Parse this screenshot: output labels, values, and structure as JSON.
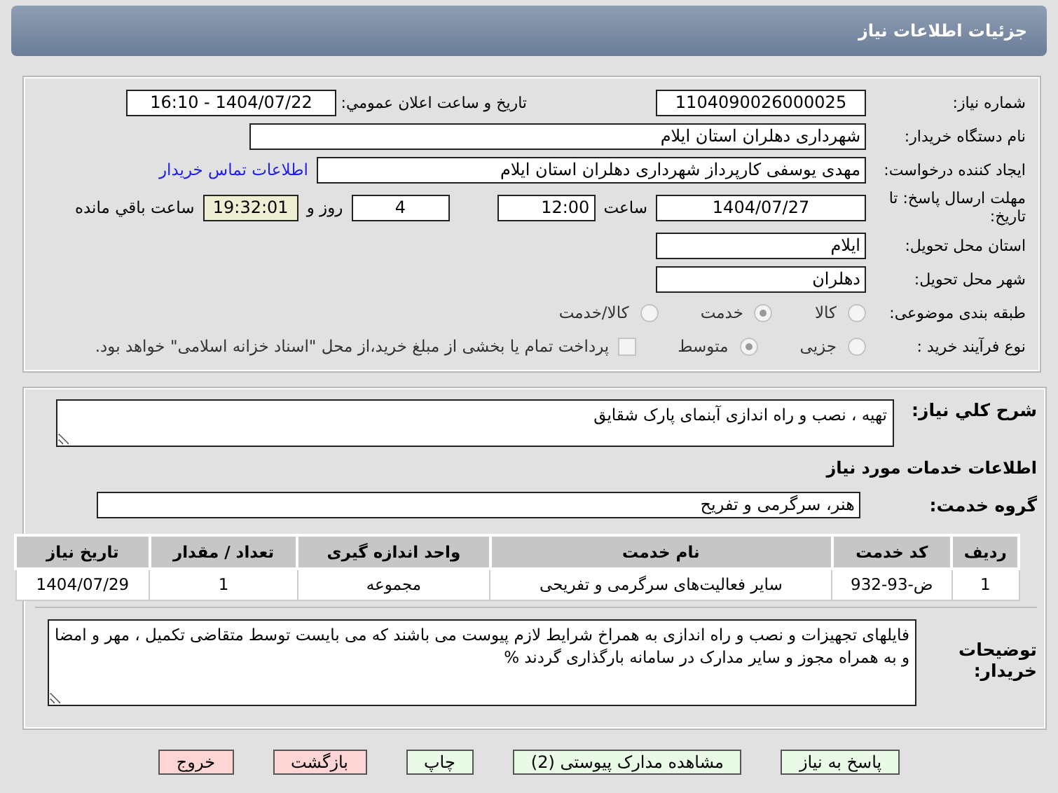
{
  "header": {
    "title": "جزئیات اطلاعات نیاز"
  },
  "details": {
    "need_number": {
      "label": "شماره نیاز:",
      "value": "1104090026000025"
    },
    "announce": {
      "label": "تاریخ و ساعت اعلان عمومي:",
      "value": "1404/07/22 - 16:10"
    },
    "buyer": {
      "label": "نام دستگاه خریدار:",
      "value": "شهرداری دهلران استان ایلام"
    },
    "creator": {
      "label": "ایجاد کننده درخواست:",
      "value": "مهدی یوسفی کارپرداز شهرداری دهلران استان ایلام",
      "link": "اطلاعات تماس خریدار"
    },
    "deadline": {
      "label": "مهلت ارسال پاسخ: تا تاریخ:",
      "date": "1404/07/27",
      "time_label": "ساعت",
      "time": "12:00",
      "days": "4",
      "days_label": "روز و",
      "remaining": "19:32:01",
      "remaining_label": "ساعت باقي مانده"
    },
    "province": {
      "label": "استان محل تحویل:",
      "value": "ایلام"
    },
    "city": {
      "label": "شهر محل تحویل:",
      "value": "دهلران"
    },
    "category": {
      "label": "طبقه بندی موضوعی:",
      "options": [
        {
          "label": "کالا",
          "selected": false
        },
        {
          "label": "خدمت",
          "selected": true
        },
        {
          "label": "کالا/خدمت",
          "selected": false
        }
      ]
    },
    "process": {
      "label": "نوع فرآیند خرید :",
      "options": [
        {
          "label": "جزیی",
          "selected": false
        },
        {
          "label": "متوسط",
          "selected": true
        }
      ],
      "treasury": {
        "checked": false,
        "text": "پرداخت تمام یا بخشی از مبلغ خرید،از محل \"اسناد خزانه اسلامی\" خواهد بود."
      }
    }
  },
  "summary": {
    "label": "شرح كلي نياز:",
    "value": "تهیه ، نصب و راه اندازی آبنمای پارک شقایق"
  },
  "services": {
    "heading": "اطلاعات خدمات مورد نياز",
    "group_label": "گروه خدمت:",
    "group": "هنر، سرگرمی و تفریح",
    "table": {
      "columns": [
        "ردیف",
        "کد خدمت",
        "نام خدمت",
        "واحد اندازه گیری",
        "تعداد / مقدار",
        "تاریخ نیاز"
      ],
      "rows": [
        [
          "1",
          "ض-93-932",
          "سایر فعالیت‌های سرگرمی و تفریحی",
          "مجموعه",
          "1",
          "1404/07/29"
        ]
      ]
    }
  },
  "notes": {
    "label": "توضیحات خریدار:",
    "value": "فایلهای تجهیزات و نصب و راه اندازی به همراخ شرایط لازم پیوست می باشند که می بایست توسط متقاضی تکمیل ، مهر و امضا و به همراه مجوز و سایر مدارک در سامانه بارگذاری گردند %"
  },
  "buttons": [
    {
      "label": "پاسخ به نیاز",
      "kind": "primary"
    },
    {
      "label": "مشاهده مدارک پیوستی (2)",
      "kind": "primary"
    },
    {
      "label": "چاپ",
      "kind": "primary"
    },
    {
      "label": "بازگشت",
      "kind": "danger"
    },
    {
      "label": "خروج",
      "kind": "danger"
    }
  ]
}
